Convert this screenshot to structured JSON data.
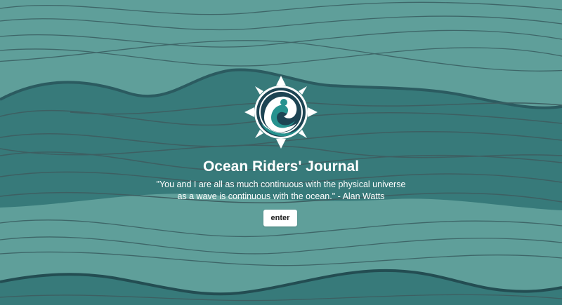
{
  "app": {
    "title": "Ocean Riders' Journal",
    "quote": "\"You and I are all as much continuous with the physical universe as a wave is continuous with the ocean.\" - Alan Watts",
    "enter_label": "enter"
  },
  "logo": {
    "icon": "compass-wave-icon"
  },
  "colors": {
    "background": "#5f9f9a",
    "dark_wave": "#377a7a",
    "wave_line": "#3d5f62",
    "logo_navy": "#1d4453",
    "logo_teal": "#27928f",
    "text": "#ffffff"
  }
}
